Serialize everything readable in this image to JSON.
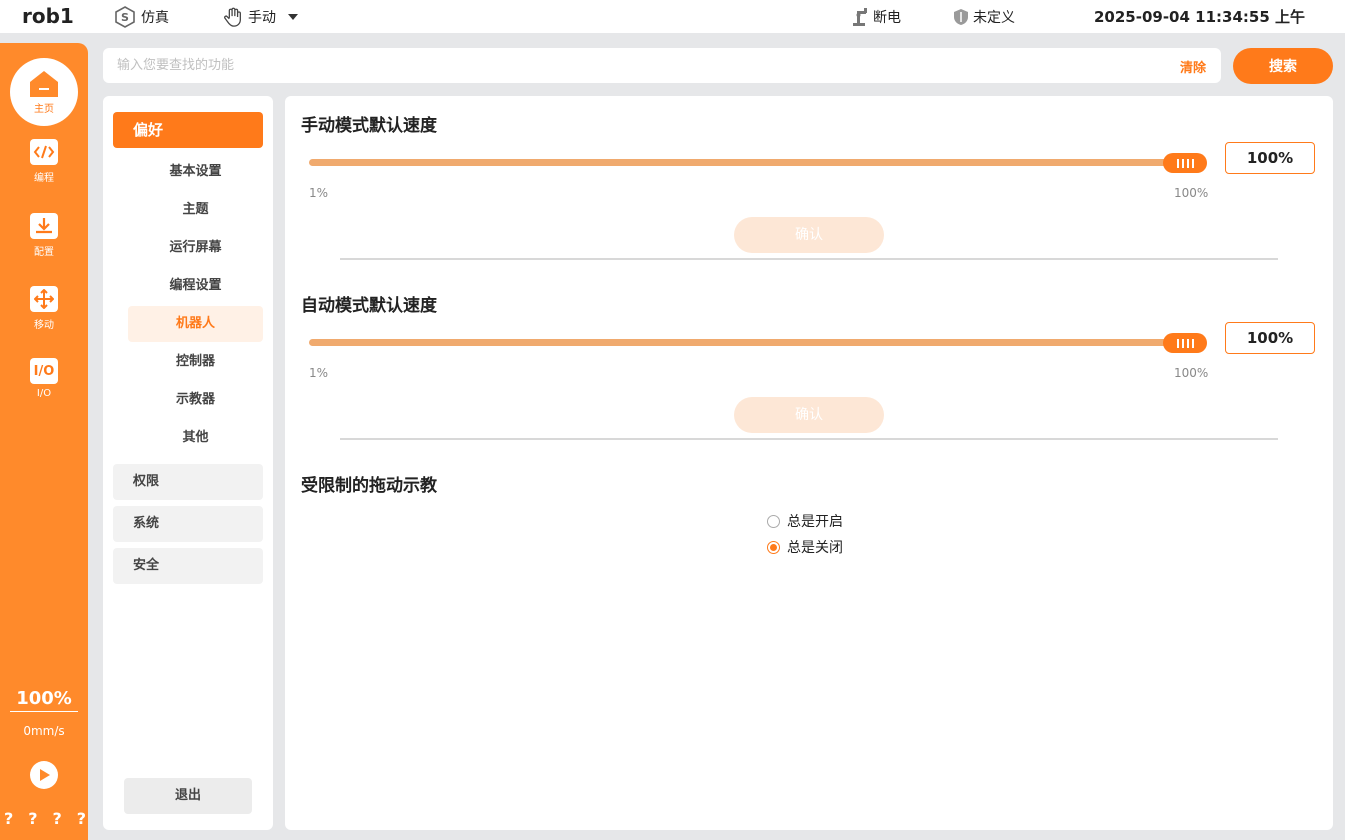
{
  "topbar": {
    "robot_name": "rob1",
    "mode_sim": "仿真",
    "mode_manual": "手动",
    "power": "断电",
    "safety": "未定义",
    "datetime": "2025-09-04 11:34:55 上午"
  },
  "rail": {
    "home_label": "主页",
    "items": [
      {
        "label": "编程",
        "icon": "code-icon"
      },
      {
        "label": "配置",
        "icon": "download-icon"
      },
      {
        "label": "移动",
        "icon": "move-icon"
      },
      {
        "label": "I/O",
        "icon_text": "I/O"
      }
    ],
    "speed": "100%",
    "velocity": "0mm/s",
    "help": [
      "?",
      "?",
      "?",
      "?"
    ]
  },
  "search": {
    "placeholder": "输入您要查找的功能",
    "clear_label": "清除",
    "button_label": "搜索"
  },
  "menu": {
    "active_category": "偏好",
    "subitems": [
      "基本设置",
      "主题",
      "运行屏幕",
      "编程设置",
      "机器人",
      "控制器",
      "示教器",
      "其他"
    ],
    "active_subitem": "机器人",
    "categories": [
      "权限",
      "系统",
      "安全"
    ],
    "logout": "退出"
  },
  "main": {
    "manual_speed": {
      "title": "手动模式默认速度",
      "value": "100%",
      "min_label": "1%",
      "max_label": "100%",
      "confirm": "确认"
    },
    "auto_speed": {
      "title": "自动模式默认速度",
      "value": "100%",
      "min_label": "1%",
      "max_label": "100%",
      "confirm": "确认"
    },
    "drag_teach": {
      "title": "受限制的拖动示教",
      "option_on": "总是开启",
      "option_off": "总是关闭",
      "selected": "总是关闭"
    }
  },
  "colors": {
    "accent": "#ff7a1a",
    "rail": "#ff8a2b",
    "track": "#f0aa6e"
  }
}
